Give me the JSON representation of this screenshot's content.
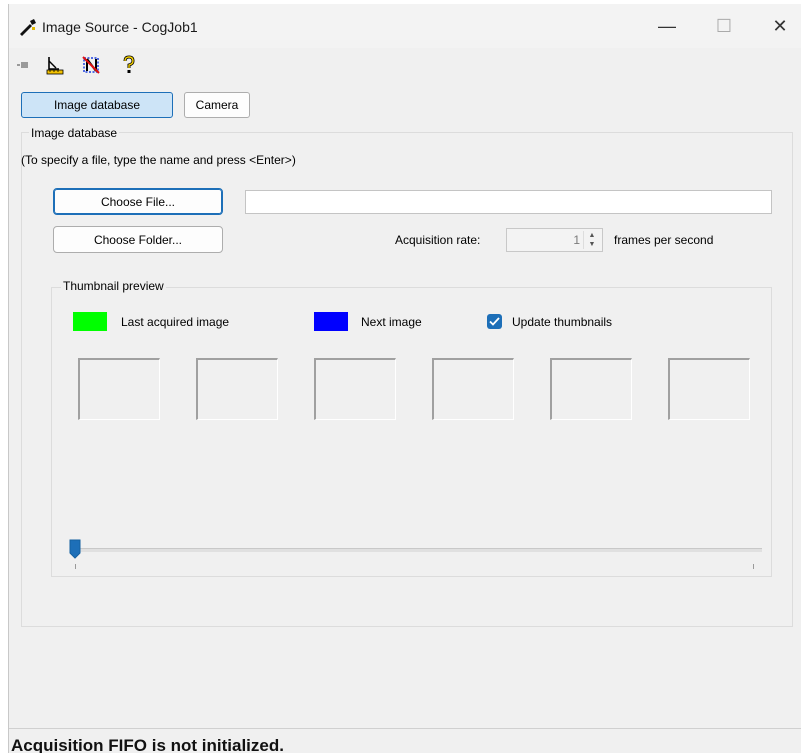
{
  "window": {
    "title": "Image Source - CogJob1",
    "minimize_glyph": "—",
    "maximize_glyph": "☐",
    "close_glyph": "✕"
  },
  "toolbar": {
    "icons": [
      "dock-icon",
      "measure-icon",
      "crop-icon",
      "help-icon"
    ]
  },
  "tabs": [
    {
      "label": "Image database",
      "active": true
    },
    {
      "label": "Camera",
      "active": false
    }
  ],
  "image_database": {
    "group_label": "Image database",
    "note": "(To specify a file, type the name and press <Enter>)",
    "choose_file_label": "Choose File...",
    "choose_folder_label": "Choose Folder...",
    "file_path_value": "",
    "acquisition_rate_label": "Acquisition rate:",
    "acquisition_rate_value": "1",
    "fps_label": "frames per second"
  },
  "thumbnail_preview": {
    "group_label": "Thumbnail preview",
    "last_acquired_label": "Last acquired image",
    "last_acquired_color": "#00ff00",
    "next_image_label": "Next image",
    "next_image_color": "#0000ff",
    "update_thumbnails_label": "Update thumbnails",
    "update_thumbnails_checked": true,
    "thumbnail_count": 6,
    "slider_position": 0
  },
  "status": {
    "text": "Acquisition FIFO is not initialized."
  },
  "colors": {
    "accent": "#1d6fb8",
    "active_tab_bg": "#cde4f7"
  }
}
